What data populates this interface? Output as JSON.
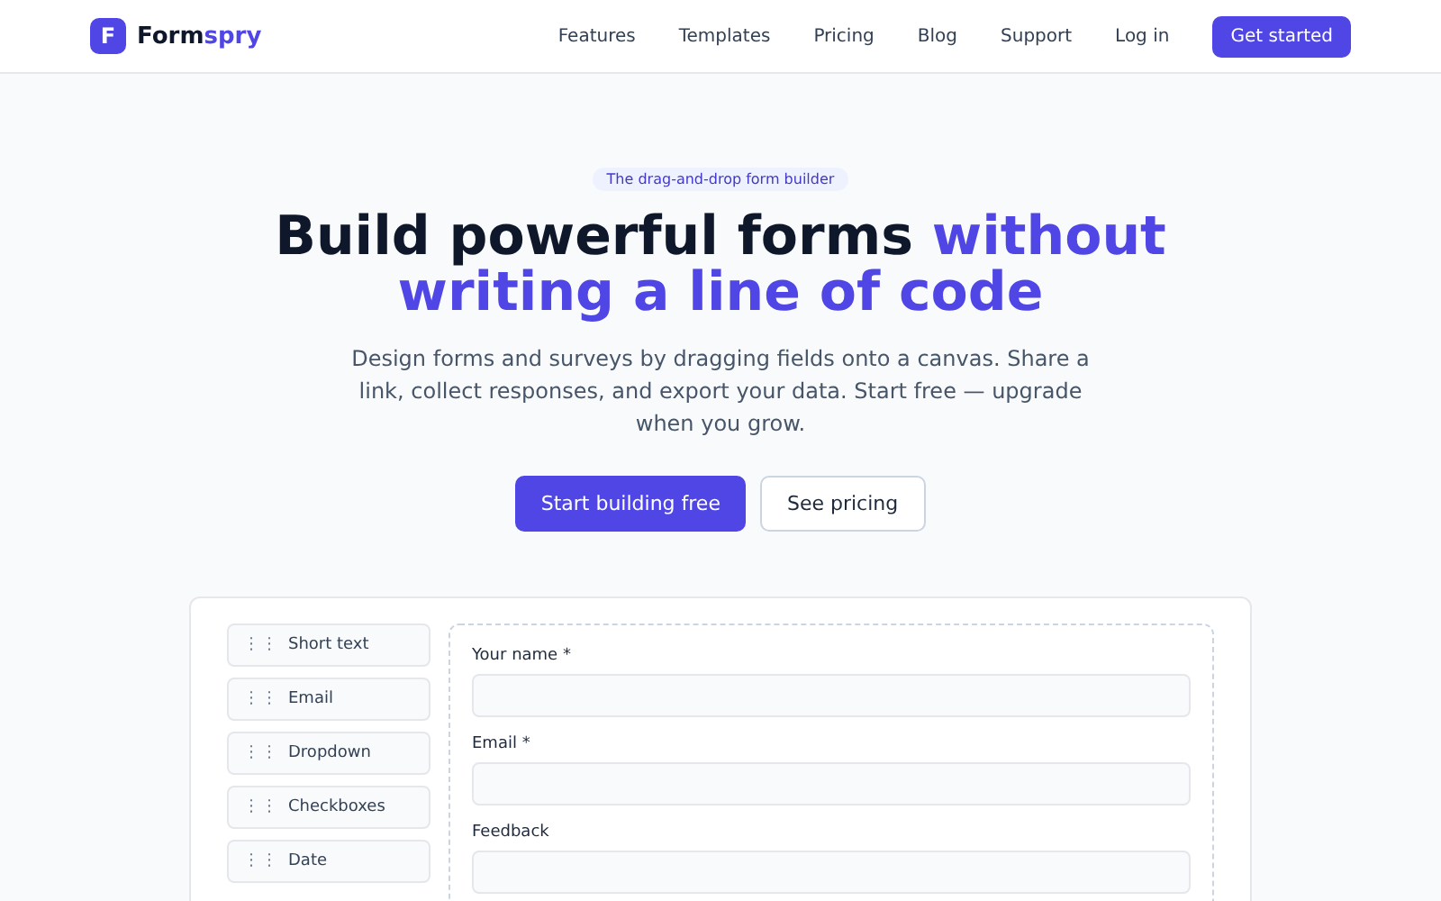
{
  "brand": {
    "initial": "F",
    "name": "Form",
    "name_accent": "spry"
  },
  "nav": [
    {
      "label": "Features"
    },
    {
      "label": "Templates"
    },
    {
      "label": "Pricing"
    },
    {
      "label": "Blog"
    },
    {
      "label": "Support"
    },
    {
      "label": "Log in"
    }
  ],
  "nav_cta": "Get started",
  "hero": {
    "badge": "The drag-and-drop form builder",
    "title": "Build powerful forms",
    "title_accent": "without writing a line of code",
    "subtitle": "Design forms and surveys by dragging fields onto a canvas. Share a link, collect responses, and export your data. Start free — upgrade when you grow.",
    "buttons": [
      {
        "label": "Start building free",
        "kind": "primary"
      },
      {
        "label": "See pricing",
        "kind": "secondary"
      }
    ]
  },
  "builder": {
    "palette": [
      {
        "handle": "⋮⋮",
        "label": "Short text"
      },
      {
        "handle": "⋮⋮",
        "label": "Email"
      },
      {
        "handle": "⋮⋮",
        "label": "Dropdown"
      },
      {
        "handle": "⋮⋮",
        "label": "Checkboxes"
      },
      {
        "handle": "⋮⋮",
        "label": "Date"
      }
    ],
    "fields": [
      {
        "label": "Your name *"
      },
      {
        "label": "Email *"
      },
      {
        "label": "Feedback"
      }
    ]
  }
}
